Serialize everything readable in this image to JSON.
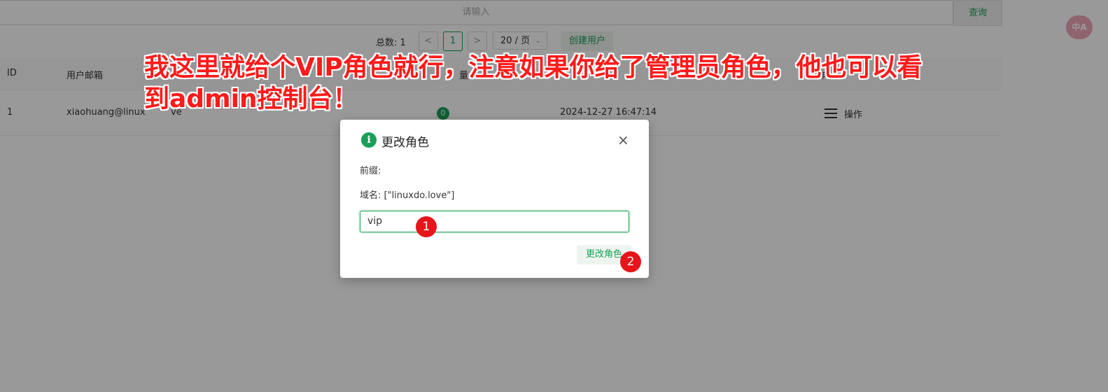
{
  "search": {
    "placeholder": "请输入",
    "button": "查询"
  },
  "pagination": {
    "total": "总数: 1",
    "prev": "<",
    "current": "1",
    "next": ">",
    "page_size": "20 / 页",
    "create_button": "创建用户"
  },
  "table": {
    "headers": {
      "id": "ID",
      "email": "用户邮箱",
      "quota": "量",
      "actions": "操作"
    },
    "rows": [
      {
        "id": "1",
        "email": "xiaohuang@linux",
        "email_tail": "ve",
        "badge": "0",
        "time": "2024-12-27 16:47:14",
        "action": "操作"
      }
    ]
  },
  "float_icon": "中A",
  "modal": {
    "icon": "i",
    "title": "更改角色",
    "close": "×",
    "prefix": "前缀:",
    "domain": "域名: [\"linuxdo.love\"]",
    "input_value": "vip",
    "submit": "更改角色"
  },
  "steps": [
    "1",
    "2"
  ],
  "annotation": {
    "line1": "我这里就给个VIP角色就行，注意如果你给了管理员角色，他也可以看",
    "line2": "到admin控制台！"
  },
  "colors": {
    "accent": "#18a058",
    "annotation": "#ff1a1a",
    "step": "#e8141c"
  }
}
